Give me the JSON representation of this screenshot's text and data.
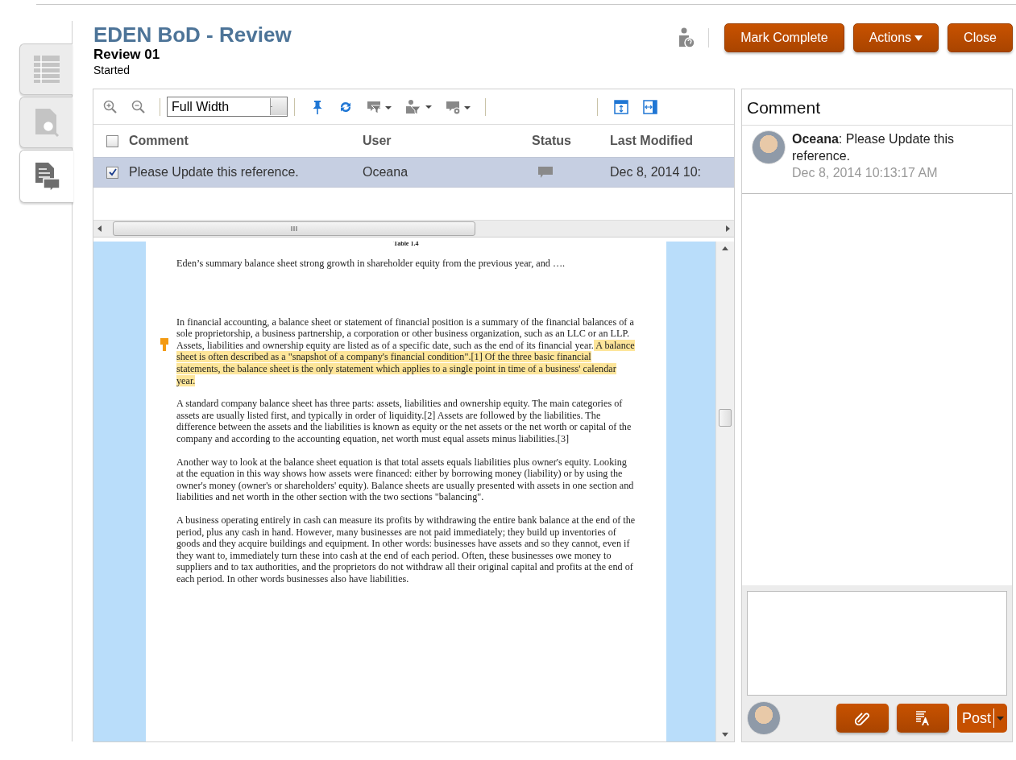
{
  "header": {
    "title": "EDEN BoD - Review",
    "subtitle": "Review 01",
    "status": "Started",
    "buttons": [
      {
        "label": "Mark Complete",
        "kind": "plain"
      },
      {
        "label": "Actions",
        "kind": "menu"
      },
      {
        "label": "Close",
        "kind": "plain"
      }
    ]
  },
  "side_tabs": [
    {
      "kind": "table",
      "selected": false
    },
    {
      "kind": "search",
      "selected": false
    },
    {
      "kind": "comments",
      "selected": true
    }
  ],
  "toolbar": {
    "zoom": "Full Width"
  },
  "comments_table": {
    "columns": [
      "Comment",
      "User",
      "Status",
      "Last Modified"
    ],
    "all_checked": false,
    "rows": [
      {
        "checked": true,
        "selected": true,
        "comment": "Please Update this reference.",
        "user": "Oceana",
        "last_modified": "Dec 8, 2014 10:"
      }
    ]
  },
  "document": {
    "caption": "Table 1.4",
    "paragraphs": [
      [
        {
          "text": "Eden’s summary balance sheet strong growth in shareholder equity from the previous year, and ….",
          "highlighted": false
        }
      ],
      [
        {
          "text": "In financial accounting, a balance sheet or statement of financial position is a summary of the financial balances of a sole proprietorship, a business partnership, a corporation or other business organization, such as an LLC or an LLP. Assets, liabilities and ownership equity are listed as of a specific date, such as the end of its financial year.",
          "highlighted": false
        },
        {
          "text": " A balance sheet is often described as a \"snapshot of a company's financial condition\".[1] Of the three basic financial statements, the balance sheet is the only statement which applies to a single point in time of a business' calendar year.",
          "highlighted": true
        }
      ],
      [
        {
          "text": "A standard company balance sheet has three parts: assets, liabilities and ownership equity. The main categories of assets are usually listed first, and typically in order of liquidity.[2] Assets are followed by the liabilities. The difference between the assets and the liabilities is known as equity or the net assets or the net worth or capital of the company and according to the accounting equation, net worth must equal assets minus liabilities.[3]",
          "highlighted": false
        }
      ],
      [
        {
          "text": "Another way to look at the balance sheet equation is that total assets equals liabilities plus owner's equity. Looking at the equation in this way shows how assets were financed: either by borrowing money (liability) or by using the owner's money (owner's or shareholders' equity). Balance sheets are usually presented with assets in one section and liabilities and net worth in the other section with the two sections \"balancing\".",
          "highlighted": false
        }
      ],
      [
        {
          "text": "A business operating entirely in cash can measure its profits by withdrawing the entire bank balance at the end of the period, plus any cash in hand. However, many businesses are not paid immediately; they build up inventories of goods and they acquire buildings and equipment. In other words: businesses have assets and so they cannot, even if they want to, immediately turn these into cash at the end of each period. Often, these businesses owe money to suppliers and to tax authorities, and the proprietors do not withdraw all their original capital and profits at the end of each period. In other words businesses also have liabilities.",
          "highlighted": false
        }
      ]
    ]
  },
  "comment_panel": {
    "title": "Comment",
    "entries": [
      {
        "text": "**Oceana**: Please Update this reference.",
        "time": "Dec 8, 2014 10:13:17 AM"
      }
    ],
    "post_button": "Post"
  }
}
